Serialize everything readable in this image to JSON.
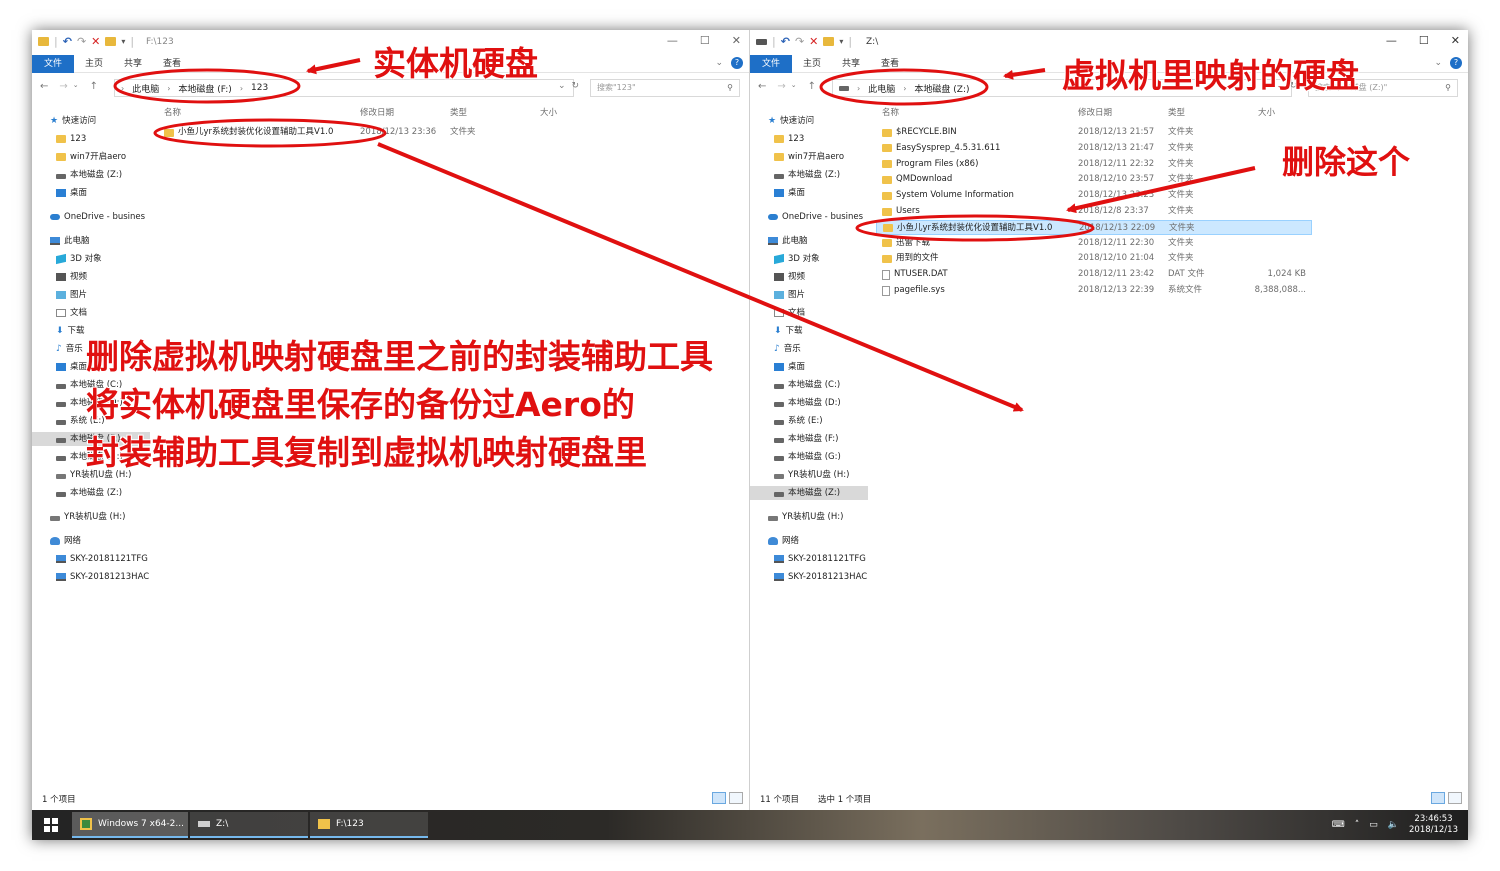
{
  "left_window": {
    "title_path": "F:\\123",
    "ribbon_tabs": [
      "文件",
      "主页",
      "共享",
      "查看"
    ],
    "breadcrumb": [
      "此电脑",
      "本地磁盘 (F:)",
      "123"
    ],
    "search_placeholder": "搜索\"123\"",
    "columns": [
      "名称",
      "修改日期",
      "类型",
      "大小"
    ],
    "files": [
      {
        "name": "小鱼儿yr系统封装优化设置辅助工具V1.0",
        "date": "2018/12/13 23:36",
        "type": "文件夹",
        "size": ""
      }
    ],
    "status": "1 个项目"
  },
  "right_window": {
    "title_path": "Z:\\",
    "ribbon_tabs": [
      "文件",
      "主页",
      "共享",
      "查看"
    ],
    "breadcrumb": [
      "此电脑",
      "本地磁盘 (Z:)"
    ],
    "search_placeholder": "搜索\"本地磁盘 (Z:)\"",
    "columns": [
      "名称",
      "修改日期",
      "类型",
      "大小"
    ],
    "files": [
      {
        "name": "$RECYCLE.BIN",
        "date": "2018/12/13 21:57",
        "type": "文件夹",
        "size": "",
        "icon": "folder"
      },
      {
        "name": "EasySysprep_4.5.31.611",
        "date": "2018/12/13 21:47",
        "type": "文件夹",
        "size": "",
        "icon": "folder"
      },
      {
        "name": "Program Files (x86)",
        "date": "2018/12/11 22:32",
        "type": "文件夹",
        "size": "",
        "icon": "folder"
      },
      {
        "name": "QMDownload",
        "date": "2018/12/10 23:57",
        "type": "文件夹",
        "size": "",
        "icon": "folder"
      },
      {
        "name": "System Volume Information",
        "date": "2018/12/13 23:23",
        "type": "文件夹",
        "size": "",
        "icon": "folder"
      },
      {
        "name": "Users",
        "date": "2018/12/8 23:37",
        "type": "文件夹",
        "size": "",
        "icon": "folder"
      },
      {
        "name": "小鱼儿yr系统封装优化设置辅助工具V1.0",
        "date": "2018/12/13 22:09",
        "type": "文件夹",
        "size": "",
        "icon": "folder",
        "selected": true
      },
      {
        "name": "迅雷下载",
        "date": "2018/12/11 22:30",
        "type": "文件夹",
        "size": "",
        "icon": "folder"
      },
      {
        "name": "用到的文件",
        "date": "2018/12/10 21:04",
        "type": "文件夹",
        "size": "",
        "icon": "folder"
      },
      {
        "name": "NTUSER.DAT",
        "date": "2018/12/11 23:42",
        "type": "DAT 文件",
        "size": "1,024 KB",
        "icon": "file"
      },
      {
        "name": "pagefile.sys",
        "date": "2018/12/13 22:39",
        "type": "系统文件",
        "size": "8,388,088...",
        "icon": "file"
      }
    ],
    "status": "11 个项目",
    "status_selected": "选中 1 个项目"
  },
  "nav_pane": {
    "left": [
      {
        "label": "快速访问",
        "icon": "star-icon",
        "indent": 0
      },
      {
        "label": "123",
        "icon": "folder-icon",
        "indent": 1
      },
      {
        "label": "win7开启aero",
        "icon": "folder-icon",
        "indent": 1
      },
      {
        "label": "本地磁盘 (Z:)",
        "icon": "drive-icon",
        "indent": 1
      },
      {
        "label": "桌面",
        "icon": "desktop-icon",
        "indent": 1
      },
      {
        "label": "OneDrive - busines",
        "icon": "cloud-icon",
        "indent": 0,
        "gap": true
      },
      {
        "label": "此电脑",
        "icon": "pc-icon",
        "indent": 0,
        "gap": true
      },
      {
        "label": "3D 对象",
        "icon": "3d-icon",
        "indent": 1
      },
      {
        "label": "视频",
        "icon": "video-icon",
        "indent": 1
      },
      {
        "label": "图片",
        "icon": "picture-icon",
        "indent": 1
      },
      {
        "label": "文档",
        "icon": "document-icon",
        "indent": 1
      },
      {
        "label": "下载",
        "icon": "download-icon",
        "indent": 1
      },
      {
        "label": "音乐",
        "icon": "music-icon",
        "indent": 1
      },
      {
        "label": "桌面",
        "icon": "desktop-icon",
        "indent": 1
      },
      {
        "label": "本地磁盘 (C:)",
        "icon": "drive-icon",
        "indent": 1
      },
      {
        "label": "本地磁盘 (D:)",
        "icon": "drive-icon",
        "indent": 1
      },
      {
        "label": "系统 (E:)",
        "icon": "drive-icon",
        "indent": 1
      },
      {
        "label": "本地磁盘 (F:)",
        "icon": "drive-icon",
        "indent": 1,
        "selected": true
      },
      {
        "label": "本地磁盘 (G:)",
        "icon": "drive-icon",
        "indent": 1
      },
      {
        "label": "YR装机U盘 (H:)",
        "icon": "usb-icon",
        "indent": 1
      },
      {
        "label": "本地磁盘 (Z:)",
        "icon": "drive-icon",
        "indent": 1
      },
      {
        "label": "YR装机U盘 (H:)",
        "icon": "usb-icon",
        "indent": 0,
        "gap": true
      },
      {
        "label": "网络",
        "icon": "network-icon",
        "indent": 0,
        "gap": true
      },
      {
        "label": "SKY-20181121TFG",
        "icon": "pc-icon",
        "indent": 1
      },
      {
        "label": "SKY-20181213HAC",
        "icon": "pc-icon",
        "indent": 1
      }
    ],
    "right": [
      {
        "label": "快速访问",
        "icon": "star-icon",
        "indent": 0
      },
      {
        "label": "123",
        "icon": "folder-icon",
        "indent": 1
      },
      {
        "label": "win7开启aero",
        "icon": "folder-icon",
        "indent": 1
      },
      {
        "label": "本地磁盘 (Z:)",
        "icon": "drive-icon",
        "indent": 1
      },
      {
        "label": "桌面",
        "icon": "desktop-icon",
        "indent": 1
      },
      {
        "label": "OneDrive - busines",
        "icon": "cloud-icon",
        "indent": 0,
        "gap": true
      },
      {
        "label": "此电脑",
        "icon": "pc-icon",
        "indent": 0,
        "gap": true
      },
      {
        "label": "3D 对象",
        "icon": "3d-icon",
        "indent": 1
      },
      {
        "label": "视频",
        "icon": "video-icon",
        "indent": 1
      },
      {
        "label": "图片",
        "icon": "picture-icon",
        "indent": 1
      },
      {
        "label": "文档",
        "icon": "document-icon",
        "indent": 1
      },
      {
        "label": "下载",
        "icon": "download-icon",
        "indent": 1
      },
      {
        "label": "音乐",
        "icon": "music-icon",
        "indent": 1
      },
      {
        "label": "桌面",
        "icon": "desktop-icon",
        "indent": 1
      },
      {
        "label": "本地磁盘 (C:)",
        "icon": "drive-icon",
        "indent": 1
      },
      {
        "label": "本地磁盘 (D:)",
        "icon": "drive-icon",
        "indent": 1
      },
      {
        "label": "系统 (E:)",
        "icon": "drive-icon",
        "indent": 1
      },
      {
        "label": "本地磁盘 (F:)",
        "icon": "drive-icon",
        "indent": 1
      },
      {
        "label": "本地磁盘 (G:)",
        "icon": "drive-icon",
        "indent": 1
      },
      {
        "label": "YR装机U盘 (H:)",
        "icon": "usb-icon",
        "indent": 1
      },
      {
        "label": "本地磁盘 (Z:)",
        "icon": "drive-icon",
        "indent": 1,
        "selected": true
      },
      {
        "label": "YR装机U盘 (H:)",
        "icon": "usb-icon",
        "indent": 0,
        "gap": true
      },
      {
        "label": "网络",
        "icon": "network-icon",
        "indent": 0,
        "gap": true
      },
      {
        "label": "SKY-20181121TFG",
        "icon": "pc-icon",
        "indent": 1
      },
      {
        "label": "SKY-20181213HAC",
        "icon": "pc-icon",
        "indent": 1
      }
    ]
  },
  "annotations": {
    "physical_disk": "实体机硬盘",
    "vm_mapped_disk": "虚拟机里映射的硬盘",
    "delete_this": "删除这个",
    "instructions": [
      "删除虚拟机映射硬盘里之前的封装辅助工具",
      "将实体机硬盘里保存的备份过Aero的",
      "封装辅助工具复制到虚拟机映射硬盘里"
    ],
    "color": "#e01010"
  },
  "taskbar": {
    "items": [
      "Windows 7 x64-2...",
      "Z:\\",
      "F:\\123"
    ],
    "time": "23:46:53",
    "date": "2018/12/13"
  }
}
